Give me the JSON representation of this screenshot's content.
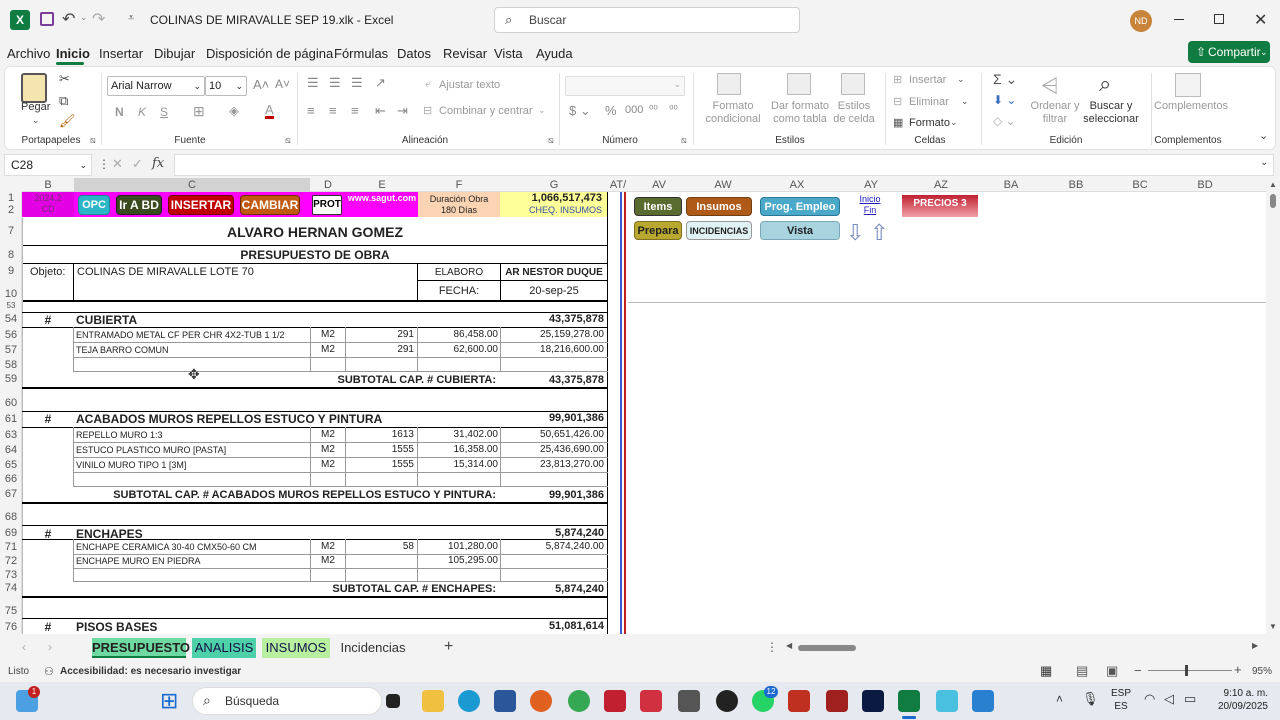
{
  "titlebar": {
    "filename": "COLINAS DE MIRAVALLE SEP 19.xlk",
    "separator": " - ",
    "app": "Excel",
    "search_placeholder": "Buscar",
    "avatar": "ND"
  },
  "menu": [
    "Archivo",
    "Inicio",
    "Insertar",
    "Dibujar",
    "Disposición de página",
    "Fórmulas",
    "Datos",
    "Revisar",
    "Vista",
    "Ayuda"
  ],
  "share": "Compartir",
  "ribbon": {
    "paste": "Pegar",
    "clipboard_label": "Portapapeles",
    "font_name": "Arial Narrow",
    "font_size": "10",
    "font_label": "Fuente",
    "wrap": "Ajustar texto",
    "merge": "Combinar y centrar",
    "align_label": "Alineación",
    "number_label": "Número",
    "cond_format": "Formato condicional",
    "table_format": "Dar formato como tabla",
    "cell_styles": "Estilos de celda",
    "styles_label": "Estilos",
    "insert": "Insertar",
    "delete": "Eliminar",
    "format": "Formato",
    "cells_label": "Celdas",
    "sort": "Ordenar y filtrar",
    "find": "Buscar y seleccionar",
    "edit_label": "Edición",
    "addins": "Complementos",
    "addins_label": "Complementos"
  },
  "namebox": "C28",
  "fx": "fx",
  "columns_left": [
    "B",
    "C",
    "D",
    "E",
    "F",
    "G",
    "AT/"
  ],
  "columns_right": [
    "AV",
    "AW",
    "AX",
    "AY",
    "AZ",
    "BA",
    "BB",
    "BC",
    "BD"
  ],
  "rows": [
    "1",
    "2",
    "7",
    "8",
    "9",
    "10",
    "53",
    "54",
    "56",
    "57",
    "58",
    "59",
    "60",
    "61",
    "63",
    "64",
    "65",
    "66",
    "67",
    "68",
    "69",
    "71",
    "72",
    "73",
    "74",
    "75",
    "76"
  ],
  "header": {
    "badge_year": "2024.2",
    "badge_cd": "CD",
    "btn_opc": "OPC",
    "btn_irabd": "Ir A BD",
    "btn_insertar": "INSERTAR",
    "btn_cambiar": "CAMBIAR",
    "btn_prot": "PROT",
    "website": "www.sagut.com",
    "duration_1": "Duración  Obra",
    "duration_2": "180 Días",
    "total": "1,066,517,473",
    "cheq": "CHEQ. INSUMOS",
    "owner": "ALVARO HERNAN GOMEZ",
    "subtitle": "PRESUPUESTO DE OBRA",
    "objeto_label": "Objeto:",
    "objeto": "COLINAS DE MIRAVALLE LOTE 70",
    "elaboro_label": "ELABORO",
    "elaboro": "AR NESTOR DUQUE",
    "fecha_label": "FECHA:",
    "fecha": "20-sep-25"
  },
  "sections": [
    {
      "hash": "#",
      "title": "CUBIERTA",
      "total": "43,375,878",
      "items": [
        {
          "desc": "ENTRAMADO METAL CF PER CHR 4X2-TUB 1 1/2",
          "unit": "M2",
          "qty": "291",
          "price": "86,458.00",
          "amount": "25,159,278.00"
        },
        {
          "desc": "TEJA BARRO COMUN",
          "unit": "M2",
          "qty": "291",
          "price": "62,600.00",
          "amount": "18,216,600.00"
        }
      ],
      "subtotal_label": "SUBTOTAL CAP. #  CUBIERTA:",
      "subtotal": "43,375,878"
    },
    {
      "hash": "#",
      "title": "ACABADOS MUROS REPELLOS ESTUCO Y PINTURA",
      "total": "99,901,386",
      "items": [
        {
          "desc": "REPELLO MURO 1:3",
          "unit": "M2",
          "qty": "1613",
          "price": "31,402.00",
          "amount": "50,651,426.00"
        },
        {
          "desc": "ESTUCO PLASTICO MURO [PASTA]",
          "unit": "M2",
          "qty": "1555",
          "price": "16,358.00",
          "amount": "25,436,690.00"
        },
        {
          "desc": "VINILO MURO TIPO 1 [3M]",
          "unit": "M2",
          "qty": "1555",
          "price": "15,314.00",
          "amount": "23,813,270.00"
        }
      ],
      "subtotal_label": "SUBTOTAL CAP. #  ACABADOS MUROS REPELLOS ESTUCO Y PINTURA:",
      "subtotal": "99,901,386"
    },
    {
      "hash": "#",
      "title": "ENCHAPES",
      "total": "5,874,240",
      "items": [
        {
          "desc": "ENCHAPE CERAMICA 30-40 CMX50-60 CM",
          "unit": "M2",
          "qty": "58",
          "price": "101,280.00",
          "amount": "5,874,240.00"
        },
        {
          "desc": "ENCHAPE MURO EN PIEDRA",
          "unit": "M2",
          "qty": "",
          "price": "105,295.00",
          "amount": ""
        }
      ],
      "subtotal_label": "SUBTOTAL CAP. #  ENCHAPES:",
      "subtotal": "5,874,240"
    },
    {
      "hash": "#",
      "title": "PISOS BASES",
      "total": "51,081,614"
    }
  ],
  "right_buttons": {
    "items": "Items",
    "insumos": "Insumos",
    "prog": "Prog. Empleo",
    "inicio": "Inicio",
    "fin": "Fin",
    "precios": "PRECIOS 3",
    "prepara": "Prepara",
    "incidencias": "INCIDENCIAS",
    "vista": "Vista"
  },
  "sheets": [
    "PRESUPUESTO",
    "ANALISIS",
    "INSUMOS",
    "Incidencias"
  ],
  "status": {
    "ready": "Listo",
    "accessibility": "Accesibilidad: es necesario investigar",
    "zoom": "95%"
  },
  "taskbar": {
    "search": "Búsqueda",
    "lang1": "ESP",
    "lang2": "ES",
    "time": "9:10 a. m.",
    "date": "20/09/2025",
    "badge1": "1",
    "badge2": "12"
  },
  "colors": {
    "excel_green": "#107c41",
    "opc": "#2bb6c8",
    "irabd": "#3a4b1f",
    "insertar": "#c00000",
    "cambiar": "#c05a10",
    "magenta": "#ff00ff",
    "yellow": "#ffff99",
    "duration": "#fbd4b4"
  }
}
